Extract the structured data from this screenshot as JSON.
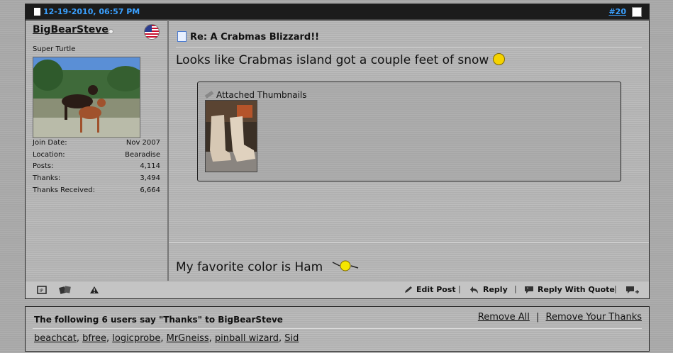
{
  "post": {
    "date": "12-19-2010, 06:57 PM",
    "number": "#20",
    "user": {
      "name": "BigBearSteve",
      "title": "Super Turtle",
      "stats": [
        {
          "label": "Join Date:",
          "value": "Nov 2007"
        },
        {
          "label": "Location:",
          "value": "Bearadise"
        },
        {
          "label": "Posts:",
          "value": "4,114"
        },
        {
          "label": "Thanks:",
          "value": "3,494"
        },
        {
          "label": "Thanks Received:",
          "value": "6,664"
        }
      ]
    },
    "title": "Re: A Crabmas Blizzard!!",
    "message": "Looks like Crabmas island got a couple feet of snow",
    "attachments_label": "Attached Thumbnails",
    "signature": "My favorite color is Ham",
    "footer": {
      "edit": "Edit Post",
      "reply": "Reply",
      "reply_quote": "Reply With Quote"
    }
  },
  "thanks": {
    "title": "The following 6 users say \"Thanks\" to BigBearSteve",
    "remove_all": "Remove All",
    "separator": "|",
    "remove_yours": "Remove Your Thanks",
    "users": [
      "beachcat",
      "bfree",
      "logicprobe",
      "MrGneiss",
      "pinball wizard",
      "Sid"
    ]
  },
  "colors": {
    "link_blue": "#3aa0ff",
    "header_bg": "#1c1c1c"
  }
}
